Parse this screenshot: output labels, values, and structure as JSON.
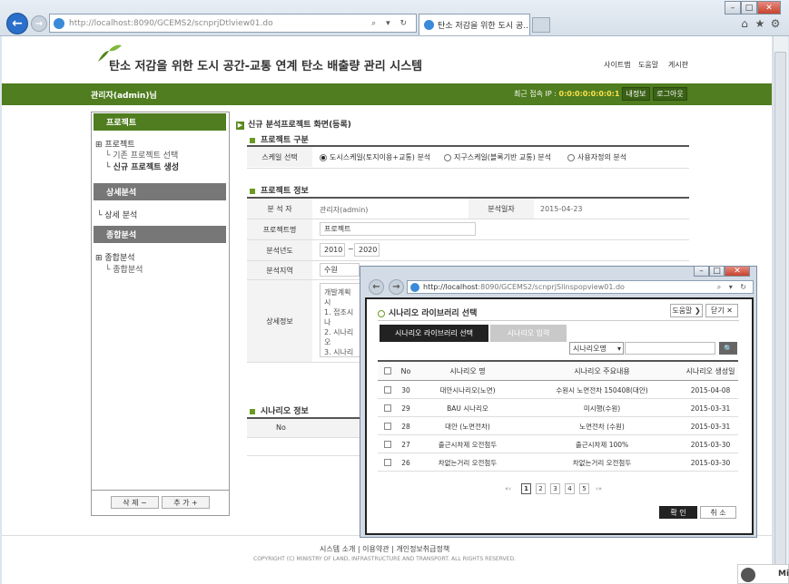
{
  "browser": {
    "url_host": "http://localhost",
    "url_path": ":8090/GCEMS2/scnprjDtlview01.do",
    "tab_title": "탄소 저감을 위한 도시 공...",
    "tab_close": "×",
    "win_min": "–",
    "win_max": "□",
    "win_close": "✕",
    "url_tools": "⌕ ▾ ↻"
  },
  "header": {
    "site_title": "탄소 저감을 위한 도시 공간-교통 연계 탄소 배출량 관리 시스템",
    "links": [
      "사이트맵",
      "도움말",
      "게시판"
    ]
  },
  "topbar": {
    "admin": "관리자(admin)님",
    "last_login_label": "최근 접속 IP : ",
    "last_login_ip": "0:0:0:0:0:0:0:1",
    "my_info": "내정보",
    "logout": "로그아웃"
  },
  "sidebar": {
    "sections": [
      {
        "title": "프로젝트",
        "color": "#4f7d1f"
      },
      {
        "title": "상세분석",
        "color": "#777777"
      },
      {
        "title": "종합분석",
        "color": "#777777"
      }
    ],
    "project_tree": {
      "root": "프로젝트",
      "child1": "기존 프로젝트 선택",
      "child2": "신규 프로젝트 생성"
    },
    "detail_item": "상세 분석",
    "total_tree": {
      "root": "종합분석",
      "child1": "종합분석"
    },
    "delete_btn": "삭 제 −",
    "add_btn": "추 가 +"
  },
  "main": {
    "title": "신규 분석프로젝트 화면(등록)",
    "section1": "프로젝트 구분",
    "scale_label": "스케일 선택",
    "scale_options": [
      "도시스케일(토지이용+교통) 분석",
      "지구스케일(블록기반 교통) 분석",
      "사용자정의 분석"
    ],
    "section2": "프로젝트 정보",
    "analyst_label": "분 석 자",
    "analyst_value": "관리자(admin)",
    "date_label": "분석일자",
    "date_value": "2015-04-23",
    "name_label": "프로젝트명",
    "name_value": "프로젝트",
    "year_label": "분석년도",
    "year_from": "2010",
    "year_sep": "~",
    "year_to": "2020",
    "region_label": "분석지역",
    "region_value": "수원",
    "detail_label": "상세정보",
    "detail_lines": [
      "개발계획 시",
      "1. 접조시나",
      "2. 시나리오",
      "3. 시나리오"
    ],
    "section3": "시나리오 정보",
    "scenario_col_no": "No"
  },
  "footer": {
    "links": "시스템 소개   |   이용약관   |   개인정보취급정책",
    "copyright": "COPYRIGHT (C) MINISTRY OF LAND, INFRASTRUCTURE AND TRANSPORT. ALL RIGHTS RESERVED."
  },
  "popup": {
    "url_host": "http://localhost",
    "url_path": ":8090/GCEMS2/scnprjSlinspopview01.do",
    "title": "시나리오 라이브러리 선택",
    "help": "도움말 ❯",
    "close": "닫기 ✕",
    "tab_library": "시나리오 라이브러리 선택",
    "tab_input": "시나리오 입력",
    "select_value": "시나리오명",
    "search_btn": "🔍",
    "columns": [
      "No",
      "시나리오 명",
      "시나리오 주요내용",
      "시나리오 생성일"
    ],
    "rows": [
      [
        "30",
        "대안시나리오(노면)",
        "수원시 노면전차 150408(대안)",
        "2015-04-08"
      ],
      [
        "29",
        "BAU 시나리오",
        "미시행(수원)",
        "2015-03-31"
      ],
      [
        "28",
        "대안 (노면전차)",
        "노면전차 (수원)",
        "2015-03-31"
      ],
      [
        "27",
        "출근시차제 오전첨두",
        "출근시차제 100%",
        "2015-03-30"
      ],
      [
        "26",
        "차없는거리 오전첨두",
        "차없는거리 오전첨두",
        "2015-03-30"
      ]
    ],
    "pagination": {
      "prev": "«‹",
      "pages": [
        "1",
        "2",
        "3",
        "4",
        "5"
      ],
      "next": "›»",
      "current": "1"
    },
    "confirm": "확 인",
    "cancel": "취 소"
  },
  "taskbar_text": "Mi"
}
